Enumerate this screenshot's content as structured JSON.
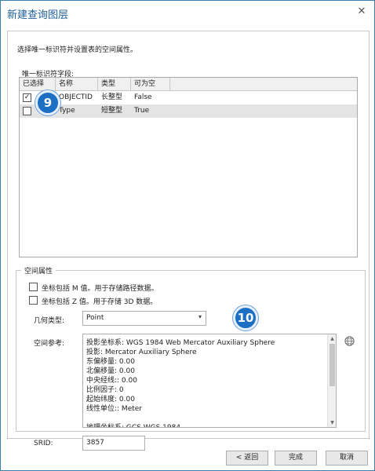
{
  "window": {
    "title": "新建查询图层"
  },
  "instruction": "选择唯一标识符并设置表的空间属性。",
  "unique_field_label": "唯一标识符字段:",
  "table": {
    "headers": [
      "已选择",
      "名称",
      "类型",
      "可为空"
    ],
    "rows": [
      {
        "selected": true,
        "name": "OBJECTID",
        "type": "长整型",
        "nullable": "False"
      },
      {
        "selected": false,
        "name": "Type",
        "type": "短整型",
        "nullable": "True"
      }
    ]
  },
  "callouts": {
    "first": "9",
    "second": "10"
  },
  "spatial": {
    "group_title": "空间属性",
    "option_m": "坐标包括 M 值。用于存储路径数据。",
    "option_z": "坐标包括 Z 值。用于存储 3D 数据。",
    "geometry_label": "几何类型:",
    "geometry_value": "Point",
    "ref_label": "空间参考:",
    "ref_lines": [
      "投影坐标系:  WGS 1984 Web Mercator Auxiliary Sphere",
      "投影:  Mercator Auxiliary Sphere",
      "东偏移量:  0.00",
      "北偏移量:  0.00",
      "中央经线::  0.00",
      "比例因子:  0",
      "起始纬度:  0.00",
      "线性单位::  Meter",
      "",
      "地理坐标系:  GCS WGS 1984"
    ],
    "srid_label": "SRID:",
    "srid_value": "3857"
  },
  "buttons": {
    "back": "< 返回",
    "finish": "完成",
    "cancel": "取消"
  }
}
